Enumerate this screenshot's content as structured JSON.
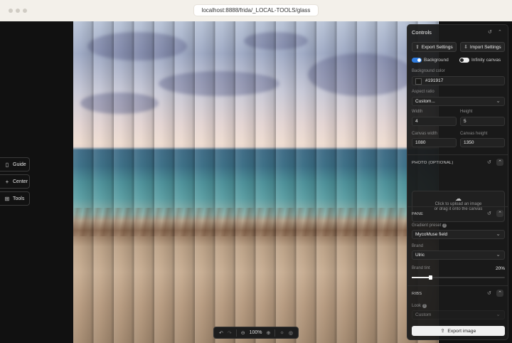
{
  "browser": {
    "url": "localhost:8888/frida/_LOCAL-TOOLS/glass"
  },
  "sidebar": [
    {
      "icon": "book-icon",
      "glyph": "▯",
      "label": "Guide"
    },
    {
      "icon": "crosshair-icon",
      "glyph": "+",
      "label": "Center"
    },
    {
      "icon": "grid-icon",
      "glyph": "⊞",
      "label": "Tools"
    }
  ],
  "zoom": {
    "value": "100%"
  },
  "controls": {
    "title": "Controls",
    "export_settings": "Export Settings",
    "import_settings": "Import Settings",
    "background_toggle": {
      "label": "Background",
      "on": true
    },
    "infinity_toggle": {
      "label": "Infinity canvas",
      "on": false
    },
    "background_color": {
      "label": "Background color",
      "value": "#191917",
      "swatch": "#191917"
    },
    "aspect_ratio": {
      "label": "Aspect ratio",
      "value": "Custom..."
    },
    "width": {
      "label": "Width",
      "value": "4"
    },
    "height": {
      "label": "Height",
      "value": "5"
    },
    "canvas_width": {
      "label": "Canvas width",
      "value": "1080"
    },
    "canvas_height": {
      "label": "Canvas height",
      "value": "1350"
    },
    "photo_section": {
      "title": "PHOTO (OPTIONAL)",
      "upload_line1": "Click to upload an image",
      "upload_line2": "or drag it onto the canvas"
    },
    "pane_section": {
      "title": "PANE",
      "gradient_preset_label": "Gradient preset",
      "gradient_preset": "MycoMuse field",
      "brand_label": "Brand",
      "brand": "Ulric",
      "brand_tint_label": "Brand tint",
      "brand_tint": "20%",
      "brand_tint_fraction": 0.2
    },
    "ribs_section": {
      "title": "RIBS",
      "look_label": "Look",
      "look": "Custom"
    },
    "export_image": "Export image"
  },
  "colors": {
    "accent": "#2f7de1"
  }
}
